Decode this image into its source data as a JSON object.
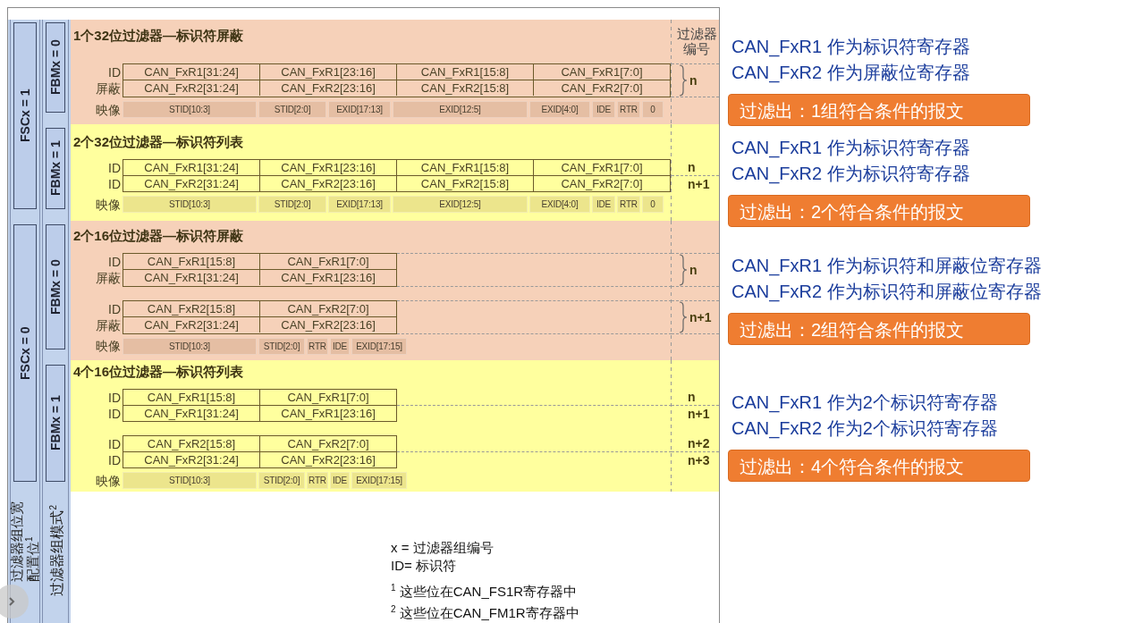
{
  "left_panel": {
    "width_settings": [
      "FSCx = 1",
      "FSCx = 0"
    ],
    "width_caption": "过滤器组位宽配置位$^{1}$",
    "mode_settings": [
      "FBMx = 0",
      "FBMx = 1",
      "FBMx = 0",
      "FBMx = 1"
    ],
    "mode_caption": "过滤器组模式$^{2}$"
  },
  "filter_number_header": "过滤器编号",
  "sections": [
    {
      "title": "1个32位过滤器—标识符屏蔽",
      "kind": "mask",
      "color": "#f6d1b9",
      "groups": [
        {
          "number": "n",
          "rows": [
            {
              "label": "ID",
              "cells": [
                "CAN_FxR1[31:24]",
                "CAN_FxR1[23:16]",
                "CAN_FxR1[15:8]",
                "CAN_FxR1[7:0]"
              ]
            },
            {
              "label": "屏蔽",
              "cells": [
                "CAN_FxR2[31:24]",
                "CAN_FxR2[23:16]",
                "CAN_FxR2[15:8]",
                "CAN_FxR2[7:0]"
              ]
            }
          ]
        }
      ],
      "mapping": {
        "label": "映像",
        "cells": [
          "STID[10:3]",
          "STID[2:0]",
          "EXID[17:13]",
          "EXID[12:5]",
          "EXID[4:0]",
          "IDE",
          "RTR",
          "0"
        ]
      }
    },
    {
      "title": "2个32位过滤器—标识符列表",
      "kind": "list",
      "color": "#ffff9e",
      "groups": [
        {
          "rows": [
            {
              "label": "ID",
              "number": "n",
              "cells": [
                "CAN_FxR1[31:24]",
                "CAN_FxR1[23:16]",
                "CAN_FxR1[15:8]",
                "CAN_FxR1[7:0]"
              ]
            },
            {
              "label": "ID",
              "number": "n+1",
              "cells": [
                "CAN_FxR2[31:24]",
                "CAN_FxR2[23:16]",
                "CAN_FxR2[15:8]",
                "CAN_FxR2[7:0]"
              ]
            }
          ]
        }
      ],
      "mapping": {
        "label": "映像",
        "cells": [
          "STID[10:3]",
          "STID[2:0]",
          "EXID[17:13]",
          "EXID[12:5]",
          "EXID[4:0]",
          "IDE",
          "RTR",
          "0"
        ]
      }
    },
    {
      "title": "2个16位过滤器—标识符屏蔽",
      "kind": "mask",
      "color": "#f6d1b9",
      "groups": [
        {
          "number": "n",
          "rows": [
            {
              "label": "ID",
              "cells": [
                "CAN_FxR1[15:8]",
                "CAN_FxR1[7:0]"
              ]
            },
            {
              "label": "屏蔽",
              "cells": [
                "CAN_FxR1[31:24]",
                "CAN_FxR1[23:16]"
              ]
            }
          ]
        },
        {
          "number": "n+1",
          "rows": [
            {
              "label": "ID",
              "cells": [
                "CAN_FxR2[15:8]",
                "CAN_FxR2[7:0]"
              ]
            },
            {
              "label": "屏蔽",
              "cells": [
                "CAN_FxR2[31:24]",
                "CAN_FxR2[23:16]"
              ]
            }
          ]
        }
      ],
      "mapping": {
        "label": "映像",
        "cells": [
          "STID[10:3]",
          "STID[2:0]",
          "RTR",
          "IDE",
          "EXID[17:15]"
        ]
      }
    },
    {
      "title": "4个16位过滤器—标识符列表",
      "kind": "list",
      "color": "#ffff9e",
      "groups": [
        {
          "rows": [
            {
              "label": "ID",
              "number": "n",
              "cells": [
                "CAN_FxR1[15:8]",
                "CAN_FxR1[7:0]"
              ]
            },
            {
              "label": "ID",
              "number": "n+1",
              "cells": [
                "CAN_FxR1[31:24]",
                "CAN_FxR1[23:16]"
              ]
            }
          ]
        },
        {
          "rows": [
            {
              "label": "ID",
              "number": "n+2",
              "cells": [
                "CAN_FxR2[15:8]",
                "CAN_FxR2[7:0]"
              ]
            },
            {
              "label": "ID",
              "number": "n+3",
              "cells": [
                "CAN_FxR2[31:24]",
                "CAN_FxR2[23:16]"
              ]
            }
          ]
        }
      ],
      "mapping": {
        "label": "映像",
        "cells": [
          "STID[10:3]",
          "STID[2:0]",
          "RTR",
          "IDE",
          "EXID[17:15]"
        ]
      }
    }
  ],
  "legend": [
    "x = 过滤器组编号",
    "ID= 标识符",
    "$^{1}$ 这些位在CAN_FS1R寄存器中",
    "$^{2}$ 这些位在CAN_FM1R寄存器中"
  ],
  "explanations": [
    {
      "lines": [
        "CAN_FxR1 作为标识符寄存器",
        "CAN_FxR2 作为屏蔽位寄存器"
      ],
      "result": "过滤出：1组符合条件的报文"
    },
    {
      "lines": [
        "CAN_FxR1 作为标识符寄存器",
        "CAN_FxR2 作为标识符寄存器"
      ],
      "result": "过滤出：2个符合条件的报文"
    },
    {
      "lines": [
        "CAN_FxR1 作为标识符和屏蔽位寄存器",
        "CAN_FxR2 作为标识符和屏蔽位寄存器"
      ],
      "result": "过滤出：2组符合条件的报文"
    },
    {
      "lines": [
        "CAN_FxR1 作为2个标识符寄存器",
        "CAN_FxR2 作为2个标识符寄存器"
      ],
      "result": "过滤出：4个符合条件的报文"
    }
  ]
}
